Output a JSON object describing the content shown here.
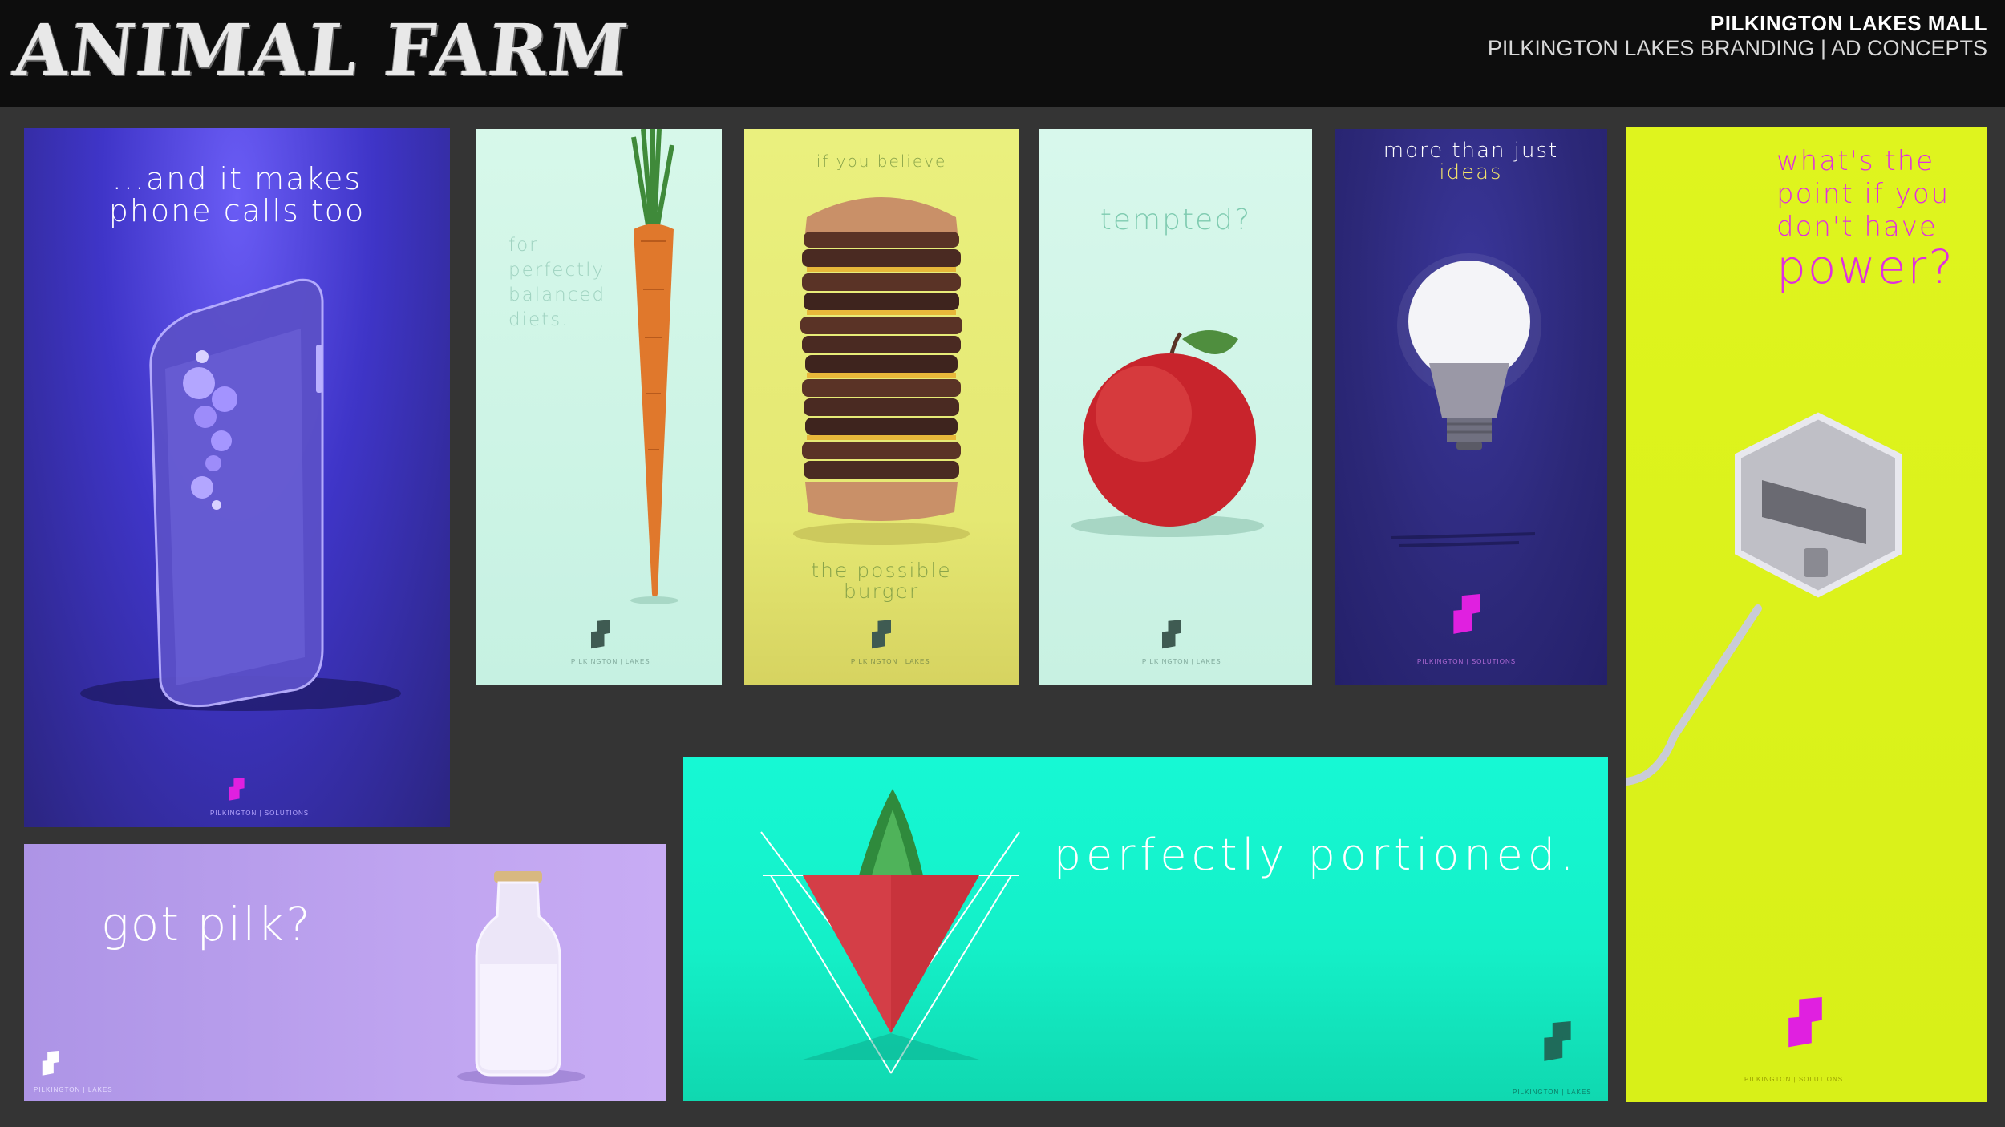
{
  "header": {
    "title": "ANIMAL FARM",
    "client": "PILKINGTON LAKES MALL",
    "subtitle": "PILKINGTON LAKES BRANDING |  AD CONCEPTS"
  },
  "colors": {
    "background": "#343434",
    "header": "#0d0d0d",
    "phone_panel": "#4a3fd6",
    "mint": "#ccf5e6",
    "yellow": "#e8ee7a",
    "navy": "#2c2878",
    "lime": "#dcf51e",
    "lavender": "#b39ae8",
    "aqua": "#16f5cc",
    "magenta": "#e020e0"
  },
  "ads": {
    "phone": {
      "line1": "...and it makes",
      "line2": "phone calls too",
      "logo_caption": "PILKINGTON | SOLUTIONS"
    },
    "carrot": {
      "line1": "for",
      "line2": "perfectly",
      "line3": "balanced",
      "line4": "diets.",
      "logo_caption": "PILKINGTON | LAKES"
    },
    "burger": {
      "top": "if you believe",
      "line1": "the possible",
      "line2": "burger",
      "logo_caption": "PILKINGTON | LAKES"
    },
    "apple": {
      "text": "tempted?",
      "logo_caption": "PILKINGTON | LAKES"
    },
    "bulb": {
      "line1": "more than just",
      "line2": "ideas",
      "logo_caption": "PILKINGTON | SOLUTIONS"
    },
    "power": {
      "line1": "what's the",
      "line2": "point if you",
      "line3": "don't have",
      "line4": "power?",
      "logo_caption": "PILKINGTON | SOLUTIONS"
    },
    "milk": {
      "text": "got pilk?",
      "logo_caption": "PILKINGTON | LAKES"
    },
    "strawberry": {
      "text": "perfectly portioned.",
      "logo_caption": "PILKINGTON | LAKES"
    }
  }
}
